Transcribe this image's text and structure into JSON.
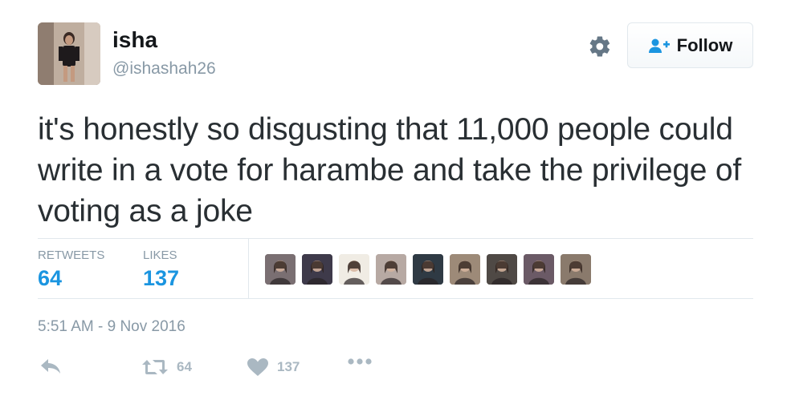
{
  "user": {
    "name": "isha",
    "handle": "@ishashah26",
    "avatar_icon": "profile-photo"
  },
  "header": {
    "settings_icon": "gear-icon",
    "follow_label": "Follow",
    "follow_icon": "add-user-icon"
  },
  "tweet": {
    "text": "it's honestly so disgusting that 11,000 people could write in a vote for harambe and take the privilege of voting as a joke",
    "timestamp": "5:51 AM - 9 Nov 2016"
  },
  "stats": {
    "retweets_label": "RETWEETS",
    "retweets_value": "64",
    "likes_label": "LIKES",
    "likes_value": "137"
  },
  "likers": [
    {
      "color": "#7a6f72"
    },
    {
      "color": "#3e3a4a"
    },
    {
      "color": "#f0ece4"
    },
    {
      "color": "#b7a9a3"
    },
    {
      "color": "#2f3a44"
    },
    {
      "color": "#9d8a78"
    },
    {
      "color": "#4f4945"
    },
    {
      "color": "#6b5a66"
    },
    {
      "color": "#8a7a6c"
    }
  ],
  "actions": {
    "reply_icon": "reply-icon",
    "retweet_icon": "retweet-icon",
    "retweet_count": "64",
    "like_icon": "heart-icon",
    "like_count": "137",
    "more_icon": "more-icon"
  },
  "colors": {
    "accent": "#1b95e0",
    "muted": "#8899a6",
    "icon": "#aab8c2",
    "border": "#e1e8ed"
  }
}
